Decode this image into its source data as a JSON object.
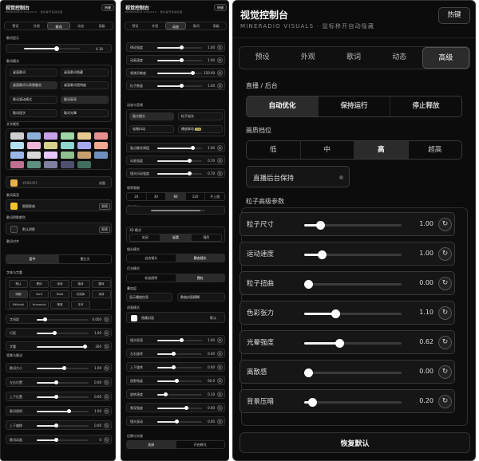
{
  "panel1": {
    "title": "视觉控制台",
    "subtitle": "MINERADIO VISUALS · 鼠标静开自动隐藏",
    "hotkey": "热键",
    "tabs": [
      "预设",
      "外观",
      "歌词",
      "动态",
      "高级"
    ],
    "active_tab": "歌词",
    "lyric_display_label": "歌词显示",
    "lyric_display_value": "0.18",
    "lyric_mode_label": "歌词模式",
    "mode_buttons": [
      "桌面歌词",
      "桌面歌词隐藏",
      "桌面歌词与背景融合",
      "桌面歌词透明度",
      "歌词滚动模式",
      "歌词高亮",
      "歌词逐字",
      "歌词光晕"
    ],
    "text_color_label": "文字颜色",
    "palette_colors": [
      "#cfcfcf",
      "#8fb0d8",
      "#c8a2e8",
      "#9fd6a8",
      "#e8c98f",
      "#e88f8f",
      "#b7e0ef",
      "#f0b6d6",
      "#d7d28a",
      "#8fd6cf",
      "#a8a8f0",
      "#f0a88f",
      "#9bb7e8",
      "#d8d8d8",
      "#e6c6ff",
      "#8fbf8f",
      "#c89f6f",
      "#6f8fbf",
      "#bf6f8f",
      "#5f8f7f",
      "#7f7f9f",
      "#4f4f6f",
      "#3f6f5f"
    ],
    "custom_color_hex": "#E8D45F",
    "custom_color_btn": "封面",
    "glow_color_label": "歌词高亮",
    "glow_color_text": "跟随歌曲",
    "glow_color_btn": "跟随",
    "shadow_label": "歌词阴影颜色",
    "shadow_text": "默认阴影",
    "shadow_btn": "跟随",
    "align_label": "歌词对齐",
    "align_options": [
      "居中",
      "靠左文"
    ],
    "font_label": "字体与字重",
    "font_options": [
      "默认",
      "黑体",
      "宋体",
      "楷体",
      "圆体",
      "明朝",
      "Serif",
      "Rude",
      "衬线体",
      "宋体",
      "Editorial",
      "Humanist",
      "等宽",
      "手写"
    ],
    "slider_group1": [
      {
        "label": "字间距",
        "value": "0.000"
      },
      {
        "label": "行距",
        "value": "1.00"
      },
      {
        "label": "字重",
        "value": "300"
      }
    ],
    "pos_label": "背景与歌词",
    "slider_group2": [
      {
        "label": "歌词大小",
        "value": "1.00"
      },
      {
        "label": "左右位置",
        "value": "0.00"
      },
      {
        "label": "上下位置",
        "value": "0.00"
      },
      {
        "label": "歌词透明",
        "value": "1.00"
      },
      {
        "label": "上下偏移",
        "value": "0.00"
      },
      {
        "label": "歌词动画",
        "value": "0"
      }
    ]
  },
  "panel2": {
    "title": "视觉控制台",
    "subtitle": "MINERADIO VISUALS · 鼠标静开自动隐藏",
    "hotkey": "热键",
    "tabs": [
      "预设",
      "外观",
      "动态",
      "歌词",
      "高级"
    ],
    "active_tab": "动态",
    "top_sliders": [
      {
        "label": "律动强度",
        "value": "1.00"
      },
      {
        "label": "动画速度",
        "value": "1.00"
      },
      {
        "label": "频谱灵敏度",
        "value": "150.00"
      },
      {
        "label": "粒子数量",
        "value": "1.00"
      }
    ],
    "section_mode": "动态与音频",
    "mode_items": [
      "鼓点镜头",
      "粒子溢光",
      "轻微抖动",
      "播放联动"
    ],
    "mode_badge": "直播",
    "mid_sliders": [
      {
        "label": "鼓点触发阈值",
        "value": "1.00"
      },
      {
        "label": "动画强度",
        "value": "0.70"
      },
      {
        "label": "镜头抖动强度",
        "value": "0.70"
      }
    ],
    "fps_label": "帧率限制",
    "fps_options": [
      "24",
      "30",
      "60",
      "120",
      "不上限"
    ],
    "fps_active": "60",
    "sync_label": "频谱同步",
    "scene_label": "3D 模式",
    "scene_tabs": [
      "关闭",
      "轻柔",
      "强烈"
    ],
    "camera_label": "镜头模式",
    "camera_options": [
      "自由镜头",
      "静态镜头"
    ],
    "lighting_label": "灯光模式",
    "lighting_options": [
      "标准照明",
      "霓虹"
    ],
    "overlay_label": "叠加层",
    "overlay_options": [
      "显示播放信息",
      "歌曲封面模糊"
    ],
    "cover_label": "封面模式",
    "cover_text": "隐藏封面",
    "cover_btn": "默认",
    "cam_sliders": [
      {
        "label": "镜头距离",
        "value": "1.00"
      },
      {
        "label": "左右旋转",
        "value": "0.00"
      },
      {
        "label": "上下旋转",
        "value": "0.00"
      },
      {
        "label": "视野角度",
        "value": "60.0"
      },
      {
        "label": "旋转速度",
        "value": "0.10"
      },
      {
        "label": "景深强度",
        "value": "0.00"
      },
      {
        "label": "镜头晃动",
        "value": "0.00"
      }
    ],
    "bottom_label": "后期与光效",
    "bottom_options": [
      "关闭",
      "开启辉光"
    ]
  },
  "panel3": {
    "title": "视觉控制台",
    "subtitle": "MINERADIO VISUALS",
    "subtitle_extra": "鼠标移开自动隐藏",
    "hotkey": "热键",
    "tabs": [
      "预设",
      "外观",
      "歌词",
      "动态",
      "高级"
    ],
    "active_tab": "高级",
    "live_label": "直播 / 后台",
    "live_options": [
      "自动优化",
      "保持运行",
      "停止释放"
    ],
    "live_active": "自动优化",
    "quality_label": "画质档位",
    "quality_options": [
      "低",
      "中",
      "高",
      "超高"
    ],
    "quality_active": "高",
    "keep_alive": "直播后台保持",
    "particle_label": "粒子高级参数",
    "sliders": [
      {
        "label": "粒子尺寸",
        "value": "1.00",
        "level": 0.16
      },
      {
        "label": "运动速度",
        "value": "1.00",
        "level": 0.18
      },
      {
        "label": "粒子扭曲",
        "value": "0.00",
        "level": 0.0
      },
      {
        "label": "色彩张力",
        "value": "1.10",
        "level": 0.32
      },
      {
        "label": "光晕强度",
        "value": "0.62",
        "level": 0.36
      },
      {
        "label": "离散感",
        "value": "0.00",
        "level": 0.0
      },
      {
        "label": "背景压暗",
        "value": "0.20",
        "level": 0.08
      }
    ],
    "reset_all": "恢复默认"
  }
}
